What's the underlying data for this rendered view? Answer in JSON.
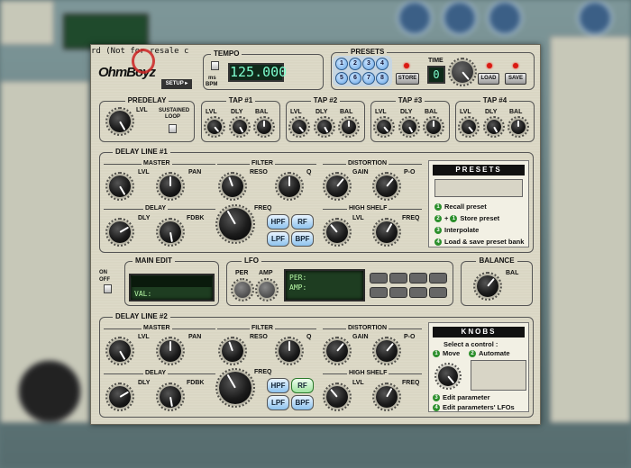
{
  "background": {
    "color": "#5f7779"
  },
  "header": {
    "scroll_text": "rd (Not for resale c",
    "logo_text": "OhmBoyz",
    "setup_label": "SETUP ▸"
  },
  "tempo": {
    "title": "TEMPO",
    "value": "125.000",
    "ms_label": "ms",
    "bpm_label": "BPM"
  },
  "presets_panel": {
    "title": "PRESETS",
    "buttons": [
      "1",
      "2",
      "3",
      "4",
      "5",
      "6",
      "7",
      "8"
    ],
    "store_label": "STORE",
    "time_label": "TIME",
    "time_value": "0",
    "load_label": "LOAD",
    "save_label": "SAVE"
  },
  "predelay": {
    "title": "PREDELAY",
    "lvl_label": "LVL",
    "sustained_label": "SUSTAINED",
    "loop_label": "LOOP"
  },
  "taps": [
    {
      "title": "TAP #1",
      "lvl": "LVL",
      "dly": "DLY",
      "bal": "BAL"
    },
    {
      "title": "TAP #2",
      "lvl": "LVL",
      "dly": "DLY",
      "bal": "BAL"
    },
    {
      "title": "TAP #3",
      "lvl": "LVL",
      "dly": "DLY",
      "bal": "BAL"
    },
    {
      "title": "TAP #4",
      "lvl": "LVL",
      "dly": "DLY",
      "bal": "BAL"
    }
  ],
  "delay_lines": [
    {
      "title": "DELAY LINE #1",
      "master": "MASTER",
      "filter": "FILTER",
      "distortion": "DISTORTION",
      "delay": "DELAY",
      "freq": "FREQ",
      "high_shelf": "HIGH SHELF",
      "lvl": "LVL",
      "pan": "PAN",
      "reso": "RESO",
      "q": "Q",
      "gain": "GAIN",
      "po": "P-O",
      "dly": "DLY",
      "fdbk": "FDBK",
      "hs_lvl": "LVL",
      "hs_freq": "FREQ",
      "filters": [
        "HPF",
        "RF",
        "LPF",
        "BPF"
      ]
    },
    {
      "title": "DELAY LINE #2",
      "master": "MASTER",
      "filter": "FILTER",
      "distortion": "DISTORTION",
      "delay": "DELAY",
      "freq": "FREQ",
      "high_shelf": "HIGH SHELF",
      "lvl": "LVL",
      "pan": "PAN",
      "reso": "RESO",
      "q": "Q",
      "gain": "GAIN",
      "po": "P-O",
      "dly": "DLY",
      "fdbk": "FDBK",
      "hs_lvl": "LVL",
      "hs_freq": "FREQ",
      "filters": [
        "HPF",
        "RF",
        "LPF",
        "BPF"
      ]
    }
  ],
  "main_edit": {
    "title": "MAIN EDIT",
    "onoff_label": "ON OFF",
    "val_label": "VAL:"
  },
  "lfo": {
    "title": "LFO",
    "per_label": "PER",
    "amp_label": "AMP",
    "lcd_per": "PER:",
    "lcd_amp": "AMP:"
  },
  "balance": {
    "title": "BALANCE",
    "bal_label": "BAL"
  },
  "help_presets": {
    "title": "PRESETS",
    "items": [
      {
        "num": "1",
        "text": "Recall preset"
      },
      {
        "num": "2",
        "text": "+",
        "num2": "1",
        "text2": "Store preset"
      },
      {
        "num": "3",
        "text": "Interpolate"
      },
      {
        "num": "4",
        "text": "Load & save preset bank"
      }
    ]
  },
  "help_knobs": {
    "title": "KNOBS",
    "subtitle": "Select a control :",
    "move": "Move",
    "automate": "Automate",
    "n1": "1",
    "n2": "2",
    "n3": "3",
    "n4": "4",
    "edit_parameter": "Edit parameter",
    "edit_lfos": "Edit parameters' LFOs"
  }
}
